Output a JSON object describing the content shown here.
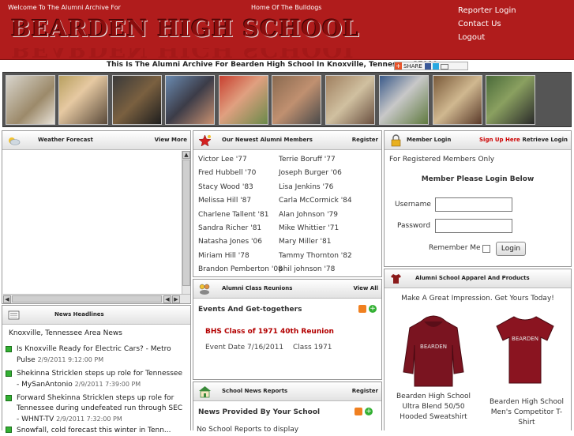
{
  "header": {
    "welcome": "Welcome To The Alumni Archive For",
    "home_of": "Home Of The Bulldogs",
    "school_name": "BEARDEN HIGH SCHOOL",
    "links": [
      "Reporter Login",
      "Contact Us",
      "Logout"
    ]
  },
  "tagline": "This Is The Alumni Archive For Bearden High School In Knoxville, Tennessee 37919",
  "share_label": "SHARE",
  "weather": {
    "title": "Weather Forecast",
    "action": "View More"
  },
  "news": {
    "title": "News Headlines",
    "heading": "Knoxville, Tennessee Area News",
    "items": [
      {
        "title": "Is Knoxville Ready for Electric Cars? - Metro Pulse",
        "date": "2/9/2011 9:12:00 PM"
      },
      {
        "title": "Shekinna Stricklen steps up role for Tennessee - MySanAntonio",
        "date": "2/9/2011 7:39:00 PM"
      },
      {
        "title": "Forward Shekinna Stricklen steps up role for Tennessee during undefeated run through SEC - WHNT-TV",
        "date": "2/9/2011 7:32:00 PM"
      },
      {
        "title": "Snowfall, cold forecast this winter in Tenn...",
        "date": ""
      }
    ]
  },
  "members": {
    "title": "Our Newest Alumni Members",
    "action": "Register",
    "left": [
      "Victor Lee '77",
      "Fred Hubbell '70",
      "Stacy Wood '83",
      "Melissa Hill '87",
      "Charlene Tallent '81",
      "Sandra Richer '81",
      "Natasha Jones '06",
      "Miriam Hill '78",
      "Brandon Pemberton '08"
    ],
    "right": [
      "Terrie Boruff '77",
      "Joseph Burger '06",
      "Lisa Jenkins '76",
      "Carla McCormick '84",
      "Alan Johnson '79",
      "Mike Whittier '71",
      "Mary Miller '81",
      "Tammy Thornton '82",
      "phil johnson '78"
    ]
  },
  "reunions": {
    "title": "Alumni Class Reunions",
    "action": "View All",
    "heading": "Events And Get-togethers",
    "event_title": "BHS Class of 1971 40th Reunion",
    "event_date": "Event Date 7/16/2011",
    "event_class": "Class 1971"
  },
  "school_news": {
    "title": "School News Reports",
    "action": "Register",
    "heading": "News Provided By Your School",
    "empty": "No School Reports to display"
  },
  "login": {
    "title": "Member Login",
    "signup": "Sign Up Here",
    "retrieve": "Retrieve Login",
    "note": "For Registered Members Only",
    "prompt": "Member Please Login Below",
    "username_label": "Username",
    "password_label": "Password",
    "remember_label": "Remember Me",
    "button": "Login"
  },
  "apparel": {
    "title": "Alumni School Apparel And Products",
    "tagline": "Make A Great Impression. Get Yours Today!",
    "products": [
      {
        "name": "Bearden High School Ultra Blend 50/50 Hooded Sweatshirt",
        "print": "BEARDEN"
      },
      {
        "name": "Bearden High School Men's Competitor T-Shirt",
        "print": "BEARDEN"
      }
    ]
  },
  "colors": {
    "brand_red": "#b01c1c",
    "title_red": "#8a0d0d",
    "link_red": "#c00000",
    "event_red": "#b30000"
  }
}
